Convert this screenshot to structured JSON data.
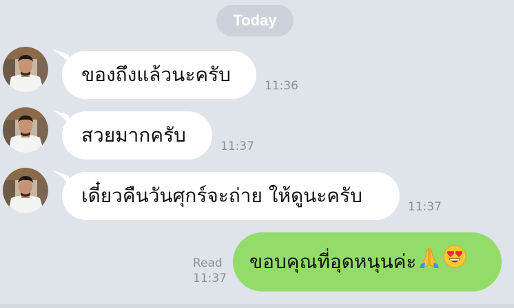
{
  "chat": {
    "date_label": "Today",
    "messages": [
      {
        "text": "ของถึงแล้วนะครับ",
        "time": "11:36"
      },
      {
        "text": "สวยมากครับ",
        "time": "11:37"
      },
      {
        "text": "เดี๋ยวคืนวันศุกร์จะถ่าย ให้ดูนะครับ",
        "time": "11:37"
      }
    ],
    "outgoing": {
      "text": "ขอบคุณที่อุดหนุนค่ะ",
      "status": "Read",
      "time": "11:37",
      "emojis": [
        "folded-hands-icon",
        "heart-eyes-face-icon"
      ]
    }
  },
  "colors": {
    "background": "#dfe3ea",
    "incoming_bubble": "#ffffff",
    "outgoing_bubble": "#93dc6a",
    "meta_text": "#8a8f98"
  }
}
